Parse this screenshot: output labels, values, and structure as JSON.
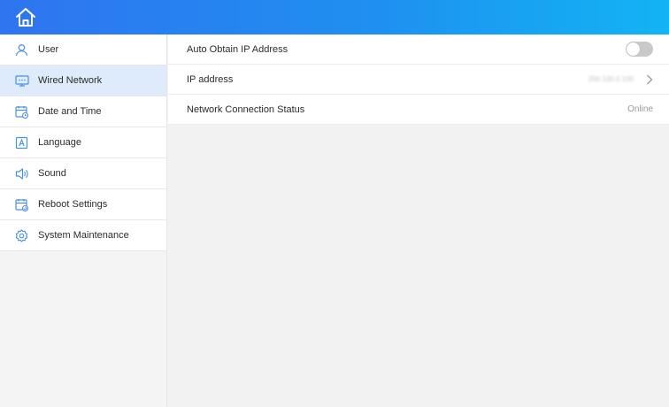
{
  "header": {
    "home_icon": "home-icon"
  },
  "sidebar": {
    "items": [
      {
        "label": "User",
        "icon": "user-icon"
      },
      {
        "label": "Wired Network",
        "icon": "network-icon"
      },
      {
        "label": "Date and Time",
        "icon": "calendar-clock-icon"
      },
      {
        "label": "Language",
        "icon": "language-icon"
      },
      {
        "label": "Sound",
        "icon": "speaker-icon"
      },
      {
        "label": "Reboot Settings",
        "icon": "calendar-reboot-icon"
      },
      {
        "label": "System Maintenance",
        "icon": "gear-icon"
      }
    ],
    "active_index": 1
  },
  "settings": {
    "auto_ip": {
      "label": "Auto Obtain IP Address",
      "enabled": false
    },
    "ip_address": {
      "label": "IP address",
      "value": "200.100.0.100"
    },
    "status": {
      "label": "Network Connection Status",
      "value": "Online"
    }
  },
  "colors": {
    "accent": "#2f74f0",
    "accent_end": "#12b4f4",
    "icon_blue": "#4a90e2",
    "active_bg": "#deebfa"
  }
}
